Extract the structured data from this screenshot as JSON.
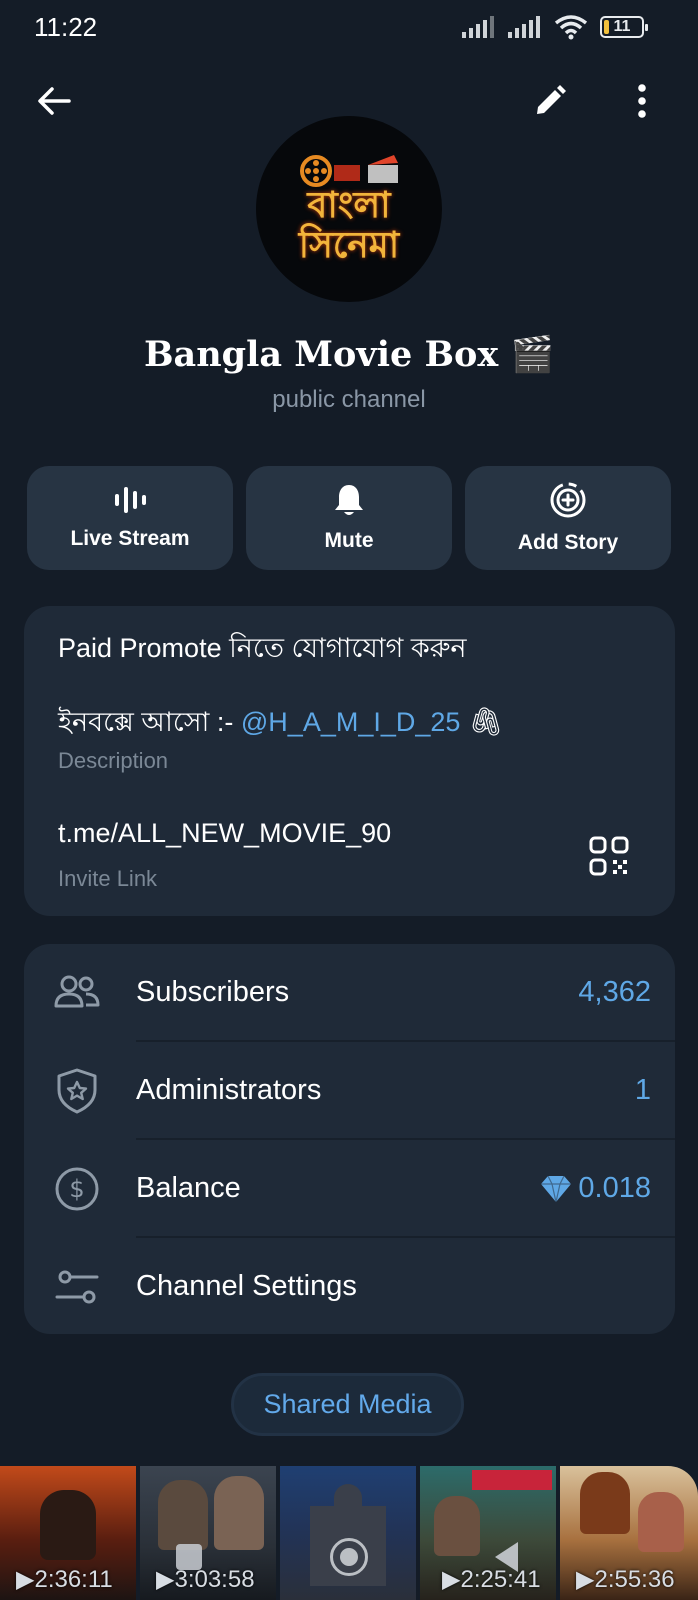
{
  "status": {
    "time": "11:22",
    "battery": "11"
  },
  "header": {
    "back_icon": "arrow-left-icon",
    "edit_icon": "pencil-icon",
    "menu_icon": "more-vertical-icon"
  },
  "avatar": {
    "line1": "বাংলা",
    "line2": "সিনেমা"
  },
  "channel": {
    "title": "Bangla Movie Box 🎬",
    "subtitle": "public channel"
  },
  "actions": [
    {
      "label": "Live Stream",
      "icon": "live-stream-icon"
    },
    {
      "label": "Mute",
      "icon": "bell-icon"
    },
    {
      "label": "Add Story",
      "icon": "add-story-icon"
    }
  ],
  "info": {
    "desc_line1": "Paid Promote নিতে যোগাযোগ করুন",
    "desc_line2_prefix": "ইনবক্সে আসো :- ",
    "desc_line2_link": "@H_A_M_I_D_25",
    "desc_line2_emoji": "🖇",
    "desc_caption": "Description",
    "invite_link": "t.me/ALL_NEW_MOVIE_90",
    "invite_caption": "Invite Link"
  },
  "rows": [
    {
      "label": "Subscribers",
      "value": "4,362",
      "icon": "people-icon"
    },
    {
      "label": "Administrators",
      "value": "1",
      "icon": "shield-star-icon"
    },
    {
      "label": "Balance",
      "value": "0.018",
      "icon": "dollar-circle-icon"
    },
    {
      "label": "Channel Settings",
      "value": "",
      "icon": "settings-sliders-icon"
    }
  ],
  "shared_media": {
    "label": "Shared Media",
    "items": [
      {
        "duration": "2:36:11",
        "bg": "#7a2b12"
      },
      {
        "duration": "3:03:58",
        "bg": "#2d343c"
      },
      {
        "duration": "",
        "bg": "#1b2f52"
      },
      {
        "duration": "2:25:41",
        "bg": "#3b4a3a"
      },
      {
        "duration": "2:55:36",
        "bg": "#9b7a4f"
      }
    ]
  },
  "colors": {
    "background": "#141c27",
    "card": "#1f2a38",
    "accent": "#5fa8e6",
    "muted": "#8a97a6"
  }
}
